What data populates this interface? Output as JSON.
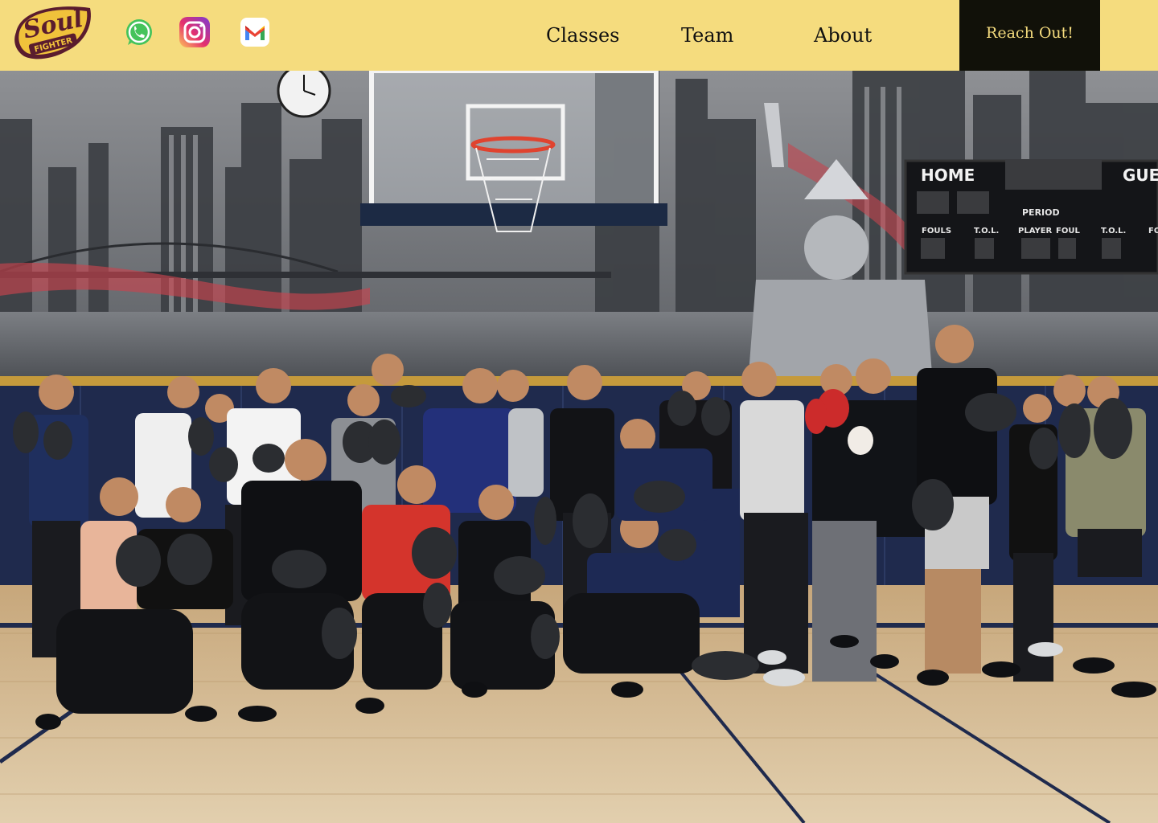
{
  "brand": {
    "logo_text_main": "Soul",
    "logo_text_sub": "FIGHTER",
    "colors": {
      "header_bg": "#f5dc7e",
      "logo_gold": "#f0c23b",
      "logo_maroon": "#5a1c2e",
      "cta_bg": "#111109",
      "cta_text": "#f5dc7e"
    }
  },
  "social": [
    {
      "name": "whatsapp-icon",
      "color": "#45c35b"
    },
    {
      "name": "instagram-icon",
      "color": "#d9307d"
    },
    {
      "name": "gmail-icon",
      "color": "#ea4335"
    }
  ],
  "nav": {
    "items": [
      {
        "label": "Classes"
      },
      {
        "label": "Team"
      },
      {
        "label": "About"
      }
    ],
    "cta_label": "Reach Out!"
  },
  "hero": {
    "alt": "Group photo of boxing class participants in a gym",
    "scoreboard": {
      "home": "HOME",
      "guest": "GUES",
      "period": "PERIOD",
      "fouls": "FOULS",
      "tol": "T.O.L.",
      "player": "PLAYER",
      "foul": "FOUL",
      "fo": "FO"
    }
  }
}
